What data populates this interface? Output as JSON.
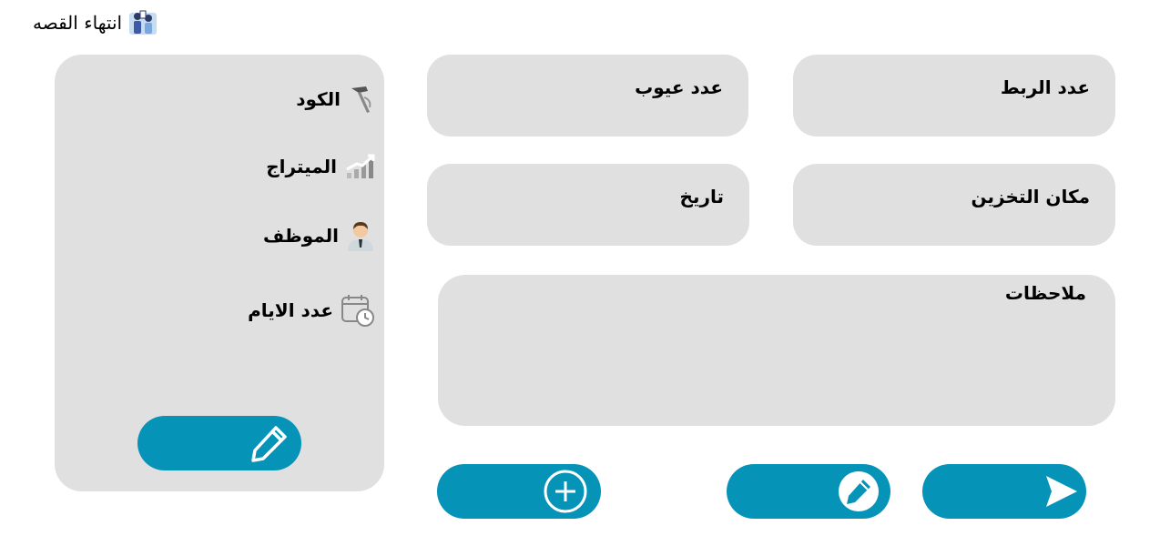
{
  "header": {
    "title": "انتهاء القصه",
    "icon": "team-icon"
  },
  "fields": {
    "binding_count": "عدد الربط",
    "defects_count": "عدد عيوب",
    "storage_location": "مكان التخزين",
    "date": "تاريخ",
    "notes": "ملاحظات"
  },
  "side_panel": {
    "code": "الكود",
    "meterage": "الميتراج",
    "employee": "الموظف",
    "days_count": "عدد الايام"
  },
  "colors": {
    "accent": "#0593b8",
    "panel": "#e0e0e0"
  }
}
